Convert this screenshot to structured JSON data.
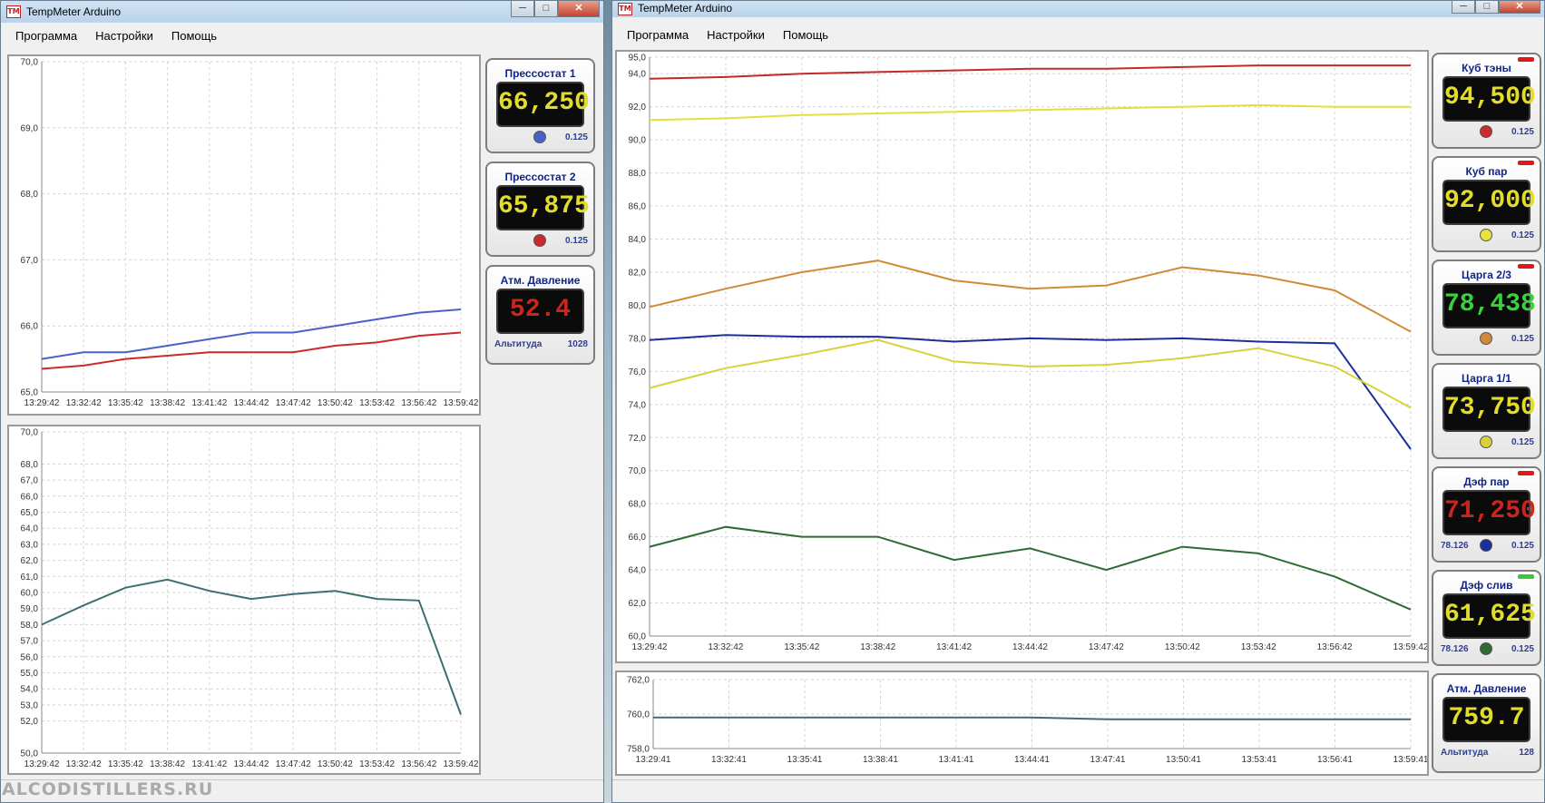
{
  "left_window": {
    "title": "TempMeter Arduino",
    "menu": [
      "Программа",
      "Настройки",
      "Помощь"
    ],
    "gauges": [
      {
        "title": "Прессостат 1",
        "value": "66,250",
        "value_color": "#e2dc2a",
        "dot_color": "#4a62c8",
        "step": "0.125"
      },
      {
        "title": "Прессостат 2",
        "value": "65,875",
        "value_color": "#e2dc2a",
        "dot_color": "#cc2a2a",
        "step": "0.125"
      },
      {
        "title": "Атм. Давление",
        "value": "52.4",
        "value_color": "#c8261e",
        "left_label": "Альтитуда",
        "step": "1028"
      }
    ],
    "chart1_y_ticks": [
      "70,0",
      "69,0",
      "68,0",
      "67,0",
      "66,0",
      "65,0"
    ],
    "chart2_y_ticks": [
      "70,0",
      "68,0",
      "67,0",
      "66,0",
      "65,0",
      "64,0",
      "63,0",
      "62,0",
      "61,0",
      "60,0",
      "59,0",
      "58,0",
      "57,0",
      "56,0",
      "55,0",
      "54,0",
      "53,0",
      "52,0",
      "50,0"
    ],
    "x_ticks": [
      "13:29:42",
      "13:32:42",
      "13:35:42",
      "13:38:42",
      "13:41:42",
      "13:44:42",
      "13:47:42",
      "13:50:42",
      "13:53:42",
      "13:56:42",
      "13:59:42"
    ]
  },
  "right_window": {
    "title": "TempMeter Arduino",
    "menu": [
      "Программа",
      "Настройки",
      "Помощь"
    ],
    "gauges": [
      {
        "title": "Куб тэны",
        "value": "94,500",
        "value_color": "#e2dc2a",
        "dot_color": "#cc2a2a",
        "step": "0.125",
        "alarm": "#e01818"
      },
      {
        "title": "Куб пар",
        "value": "92,000",
        "value_color": "#e2dc2a",
        "dot_color": "#e8e23a",
        "step": "0.125",
        "alarm": "#e01818"
      },
      {
        "title": "Царга 2/3",
        "value": "78,438",
        "value_color": "#3ad23a",
        "dot_color": "#d08a38",
        "step": "0.125",
        "alarm": "#e01818"
      },
      {
        "title": "Царга 1/1",
        "value": "73,750",
        "value_color": "#e2dc2a",
        "dot_color": "#d8d23a",
        "step": "0.125"
      },
      {
        "title": "Дэф пар",
        "value": "71,250",
        "value_color": "#c8261e",
        "dot_color": "#1a2f9a",
        "step": "0.125",
        "left_label": "78.126",
        "alarm": "#e01818"
      },
      {
        "title": "Дэф слив",
        "value": "61,625",
        "value_color": "#e2dc2a",
        "dot_color": "#2e6a32",
        "step": "0.125",
        "left_label": "78.126",
        "alarm": "#3ac83a"
      },
      {
        "title": "Атм. Давление",
        "value": "759.7",
        "value_color": "#e2dc2a",
        "left_label": "Альтитуда",
        "step": "128"
      }
    ],
    "chart_main_y_ticks": [
      "95,0",
      "94,0",
      "92,0",
      "90,0",
      "88,0",
      "86,0",
      "84,0",
      "82,0",
      "80,0",
      "78,0",
      "76,0",
      "74,0",
      "72,0",
      "70,0",
      "68,0",
      "66,0",
      "64,0",
      "62,0",
      "60,0"
    ],
    "chart_main_x_ticks": [
      "13:29:42",
      "13:32:42",
      "13:35:42",
      "13:38:42",
      "13:41:42",
      "13:44:42",
      "13:47:42",
      "13:50:42",
      "13:53:42",
      "13:56:42",
      "13:59:42"
    ],
    "chart_press_y_ticks": [
      "762,0",
      "760,0",
      "758,0"
    ],
    "chart_press_x_ticks": [
      "13:29:41",
      "13:32:41",
      "13:35:41",
      "13:38:41",
      "13:41:41",
      "13:44:41",
      "13:47:41",
      "13:50:41",
      "13:53:41",
      "13:56:41",
      "13:59:41"
    ]
  },
  "watermark": "ALCODISTILLERS.RU",
  "chart_data": [
    {
      "type": "line",
      "x": [
        "13:29:42",
        "13:32:42",
        "13:35:42",
        "13:38:42",
        "13:41:42",
        "13:44:42",
        "13:47:42",
        "13:50:42",
        "13:53:42",
        "13:56:42",
        "13:59:42"
      ],
      "ylim": [
        65,
        70
      ],
      "grid": true,
      "series": [
        {
          "color": "#4a62c8",
          "values": [
            65.5,
            65.6,
            65.6,
            65.7,
            65.8,
            65.9,
            65.9,
            66.0,
            66.1,
            66.2,
            66.25
          ]
        },
        {
          "color": "#cc2a2a",
          "values": [
            65.35,
            65.4,
            65.5,
            65.55,
            65.6,
            65.6,
            65.6,
            65.7,
            65.75,
            65.85,
            65.9
          ]
        }
      ]
    },
    {
      "type": "line",
      "x": [
        "13:29:42",
        "13:32:42",
        "13:35:42",
        "13:38:42",
        "13:41:42",
        "13:44:42",
        "13:47:42",
        "13:50:42",
        "13:53:42",
        "13:56:42",
        "13:59:42"
      ],
      "ylim": [
        50,
        70
      ],
      "grid": true,
      "series": [
        {
          "color": "#3e6e72",
          "values": [
            58.0,
            59.2,
            60.3,
            60.8,
            60.1,
            59.6,
            59.9,
            60.1,
            59.6,
            59.5,
            52.4
          ]
        }
      ]
    },
    {
      "type": "line",
      "x": [
        "13:29:42",
        "13:32:42",
        "13:35:42",
        "13:38:42",
        "13:41:42",
        "13:44:42",
        "13:47:42",
        "13:50:42",
        "13:53:42",
        "13:56:42",
        "13:59:42"
      ],
      "ylim": [
        60,
        95
      ],
      "grid": true,
      "series": [
        {
          "color": "#c62828",
          "values": [
            93.7,
            93.8,
            94.0,
            94.1,
            94.2,
            94.3,
            94.3,
            94.4,
            94.5,
            94.5,
            94.5
          ]
        },
        {
          "color": "#e4df3c",
          "values": [
            91.2,
            91.3,
            91.5,
            91.6,
            91.7,
            91.8,
            91.9,
            92.0,
            92.1,
            92.0,
            92.0
          ]
        },
        {
          "color": "#d08a38",
          "values": [
            79.9,
            81.0,
            82.0,
            82.7,
            81.5,
            81.0,
            81.2,
            82.3,
            81.8,
            80.9,
            78.4
          ]
        },
        {
          "color": "#1a2f9a",
          "values": [
            77.9,
            78.2,
            78.1,
            78.1,
            77.8,
            78.0,
            77.9,
            78.0,
            77.8,
            77.7,
            71.3
          ]
        },
        {
          "color": "#d8d23a",
          "values": [
            75.0,
            76.2,
            77.0,
            77.9,
            76.6,
            76.3,
            76.4,
            76.8,
            77.4,
            76.3,
            73.8
          ]
        },
        {
          "color": "#2e6a32",
          "values": [
            65.4,
            66.6,
            66.0,
            66.0,
            64.6,
            65.3,
            64.0,
            65.4,
            65.0,
            63.6,
            61.6
          ]
        }
      ]
    },
    {
      "type": "line",
      "x": [
        "13:29:41",
        "13:32:41",
        "13:35:41",
        "13:38:41",
        "13:41:41",
        "13:44:41",
        "13:47:41",
        "13:50:41",
        "13:53:41",
        "13:56:41",
        "13:59:41"
      ],
      "ylim": [
        758,
        762
      ],
      "grid": true,
      "series": [
        {
          "color": "#3e6e72",
          "values": [
            759.8,
            759.8,
            759.8,
            759.8,
            759.8,
            759.8,
            759.7,
            759.7,
            759.7,
            759.7,
            759.7
          ]
        }
      ]
    }
  ]
}
